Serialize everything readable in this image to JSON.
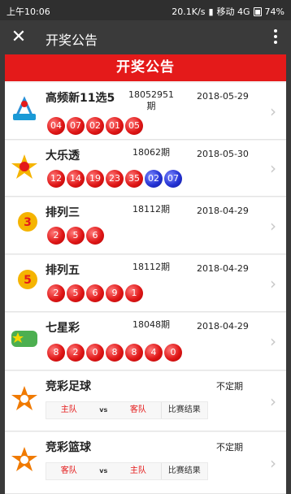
{
  "status": {
    "time": "上午10:06",
    "speed": "20.1K/s",
    "carrier": "移动 4G",
    "battery": "74%"
  },
  "titlebar": {
    "title": "开奖公告"
  },
  "banner": {
    "label": "开奖公告"
  },
  "lotteries": [
    {
      "name": "高频新11选5",
      "period": "18052951期",
      "date": "2018-05-29",
      "red": [
        "04",
        "07",
        "02",
        "01",
        "05"
      ],
      "blue": []
    },
    {
      "name": "大乐透",
      "period": "18062期",
      "date": "2018-05-30",
      "red": [
        "12",
        "14",
        "19",
        "23",
        "35"
      ],
      "blue": [
        "02",
        "07"
      ]
    },
    {
      "name": "排列三",
      "period": "18112期",
      "date": "2018-04-29",
      "red": [
        "2",
        "5",
        "6"
      ],
      "blue": []
    },
    {
      "name": "排列五",
      "period": "18112期",
      "date": "2018-04-29",
      "red": [
        "2",
        "5",
        "6",
        "9",
        "1"
      ],
      "blue": []
    },
    {
      "name": "七星彩",
      "period": "18048期",
      "date": "2018-04-29",
      "red": [
        "8",
        "2",
        "0",
        "8",
        "8",
        "4",
        "0"
      ],
      "blue": []
    }
  ],
  "sports": [
    {
      "name": "竞彩足球",
      "schedule": "不定期",
      "home": "主队",
      "vs": "vs",
      "away": "客队",
      "result": "比赛结果"
    },
    {
      "name": "竞彩篮球",
      "schedule": "不定期",
      "home": "客队",
      "vs": "vs",
      "away": "主队",
      "result": "比赛结果"
    }
  ],
  "colors": {
    "accent": "#e41a1a",
    "ball_blue": "#2533d4"
  }
}
